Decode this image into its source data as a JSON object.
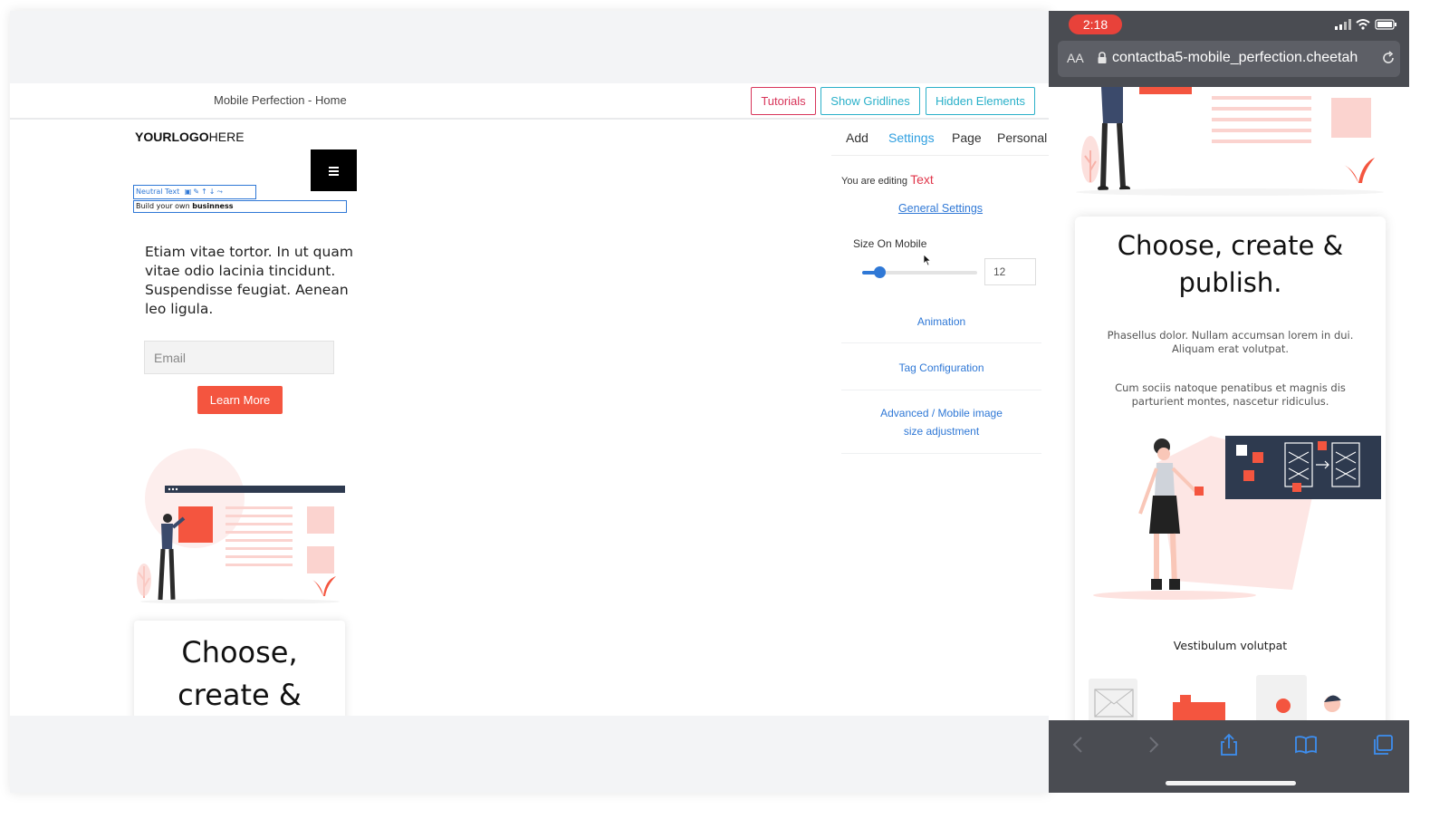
{
  "editor": {
    "page_title": "Mobile Perfection - Home",
    "toolbar": {
      "tutorials": "Tutorials",
      "show_gridlines": "Show Gridlines",
      "hidden_elements": "Hidden Elements"
    },
    "preview": {
      "logo_bold": "YOURLOGO",
      "logo_light": "HERE",
      "edit_bar_label": "Neutral Text",
      "edit_target_normal": "Build your own ",
      "edit_target_bold": "businness",
      "body_text": "Etiam vitae tortor. In ut quam vitae odio lacinia tincidunt. Suspendisse feugiat. Aenean leo ligula.",
      "email_placeholder": "Email",
      "learn_more": "Learn More",
      "card_title": "Choose, create &"
    },
    "panel": {
      "tabs": [
        "Add",
        "Settings",
        "Page",
        "Personal"
      ],
      "active_tab": "Settings",
      "editing_prefix": "You are editing",
      "editing_kind": "Text",
      "general_settings": "General Settings",
      "size_on_mobile_label": "Size On Mobile",
      "size_on_mobile_value": "12",
      "slider_level": 0.15,
      "links": {
        "animation": "Animation",
        "tag_configuration": "Tag Configuration",
        "advanced_line1": "Advanced / Mobile image",
        "advanced_line2": "size adjustment"
      }
    }
  },
  "phone": {
    "time": "2:18",
    "aa": "AA",
    "url": "contactba5-mobile_perfection.cheetah",
    "card": {
      "title_line1": "Choose, create &",
      "title_line2": "publish.",
      "para1": "Phasellus dolor. Nullam accumsan lorem in dui. Aliquam erat volutpat.",
      "para2": "Cum sociis natoque penatibus et magnis dis parturient montes, nascetur ridiculus.",
      "caption": "Vestibulum volutpat"
    }
  },
  "colors": {
    "accent_red": "#f4553f",
    "tutorials_pink": "#d8355a",
    "teal": "#2ab0c9",
    "link_blue": "#2f78d6",
    "phone_chrome": "#4a4c52",
    "time_pill": "#e8423a"
  },
  "icons": {
    "edit_bar": [
      "save-icon",
      "pencil-icon",
      "arrow-up-icon",
      "arrow-down-icon",
      "unlink-icon"
    ],
    "phone_toolbar": [
      "back-icon",
      "forward-icon",
      "share-icon",
      "bookmarks-icon",
      "tabs-icon"
    ]
  }
}
